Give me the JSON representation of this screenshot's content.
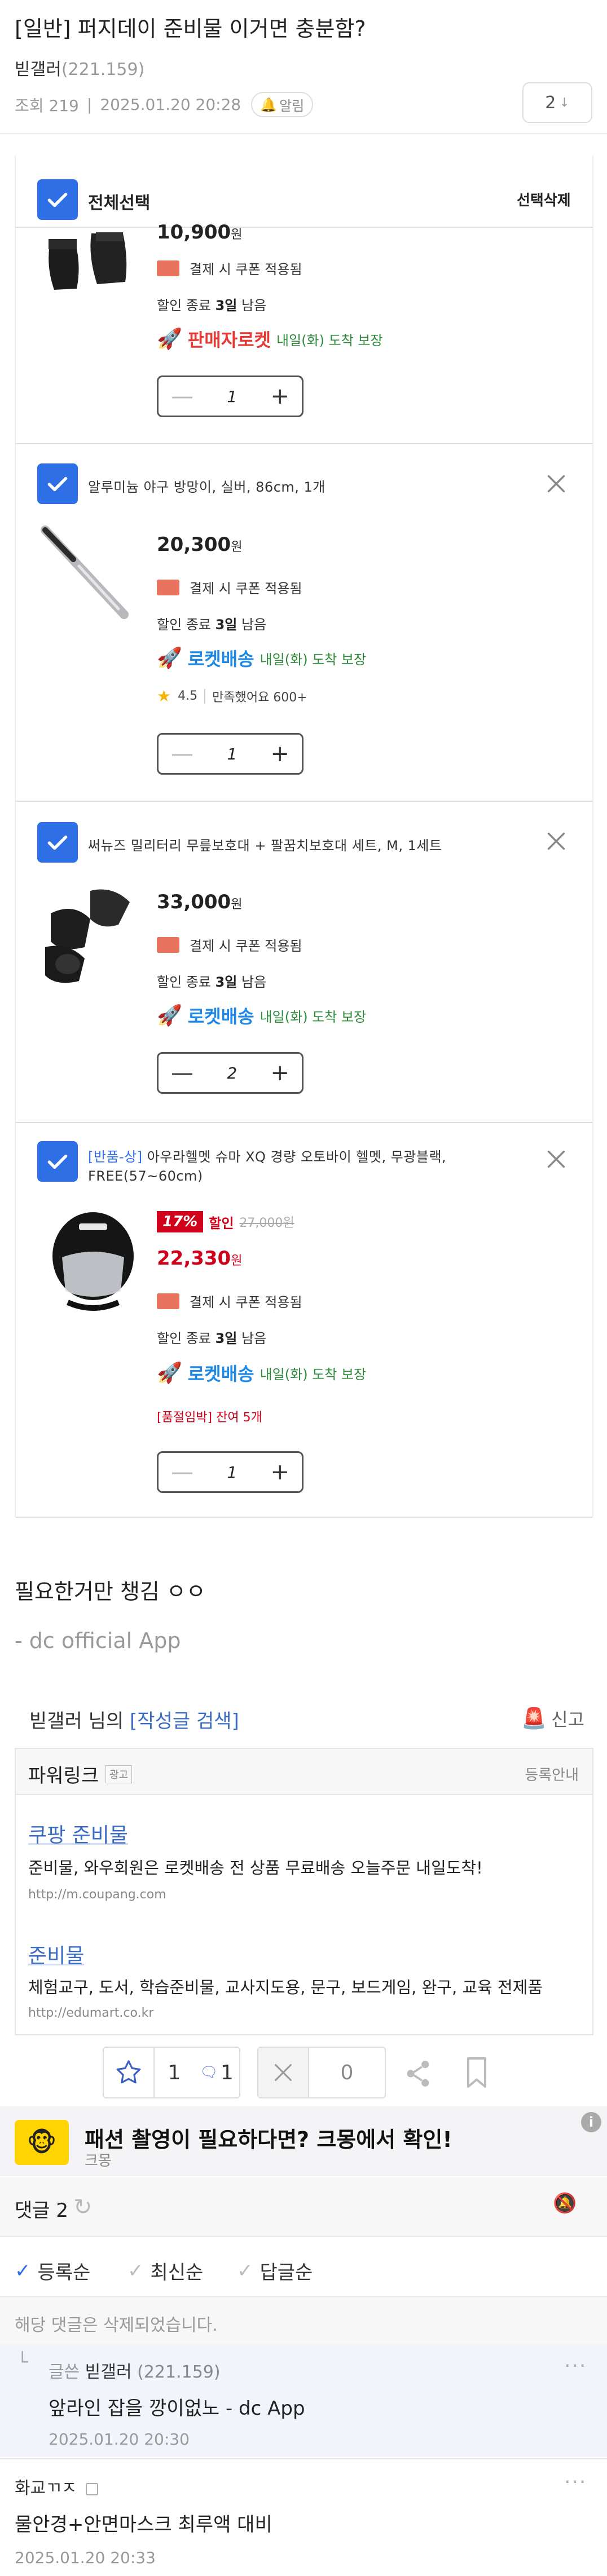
{
  "post": {
    "title": "[일반] 퍼지데이 준비물 이거면 충분함?",
    "author": "빋갤러",
    "author_ip": "(221.159)",
    "views_label": "조회 219",
    "date": "2025.01.20 20:28",
    "alarm_label": "알림",
    "comment_count": "2"
  },
  "cart": {
    "select_all_label": "전체선택",
    "delete_selected_label": "선택삭제",
    "items": [
      {
        "price": "10,900",
        "won": "원",
        "coupon": "결제 시 쿠폰 적용됨",
        "deal_end_prefix": "할인 종료",
        "deal_end_days": "3일",
        "deal_end_suffix": "남음",
        "delivery_brand": "판매자로켓",
        "delivery_when": "내일(화) 도착 보장",
        "qty": "1"
      },
      {
        "name": "알루미늄 야구 방망이, 실버, 86cm, 1개",
        "price": "20,300",
        "won": "원",
        "coupon": "결제 시 쿠폰 적용됨",
        "deal_end_prefix": "할인 종료",
        "deal_end_days": "3일",
        "deal_end_suffix": "남음",
        "delivery_brand": "로켓배송",
        "delivery_when": "내일(화) 도착 보장",
        "rating": "4.5",
        "bought": "만족했어요 600+",
        "qty": "1"
      },
      {
        "name": "써뉴즈 밀리터리 무릎보호대 + 팔꿈치보호대 세트, M, 1세트",
        "price": "33,000",
        "won": "원",
        "coupon": "결제 시 쿠폰 적용됨",
        "deal_end_prefix": "할인 종료",
        "deal_end_days": "3일",
        "deal_end_suffix": "남음",
        "delivery_brand": "로켓배송",
        "delivery_when": "내일(화) 도착 보장",
        "qty": "2"
      },
      {
        "name_tag": "[반품-상]",
        "name_line1": "아우라헬멧 슈마 XQ 경량 오토바이 헬멧, 무광블랙,",
        "name_line2": "FREE(57~60cm)",
        "discount_badge": "17%",
        "discount_word": "할인",
        "orig_price": "27,000원",
        "price": "22,330",
        "won": "원",
        "coupon": "결제 시 쿠폰 적용됨",
        "deal_end_prefix": "할인 종료",
        "deal_end_days": "3일",
        "deal_end_suffix": "남음",
        "delivery_brand": "로켓배송",
        "delivery_when": "내일(화) 도착 보장",
        "stock": "[품절임박] 잔여 5개",
        "qty": "1"
      }
    ]
  },
  "body": {
    "line1": "필요한거만 챙김 ㅇㅇ",
    "line2": "- dc official App"
  },
  "author_search": {
    "prefix": "빋갤러 님의",
    "link": "[작성글 검색]",
    "report_label": "신고"
  },
  "powerlink": {
    "title": "파워링크",
    "ad_chip": "광고",
    "register_label": "등록안내",
    "ads": [
      {
        "title": "쿠팡 준비물",
        "desc": "준비물, 와우회원은 로켓배송 전 상품 무료배송 오늘주문 내일도착!",
        "url": "http://m.coupang.com"
      },
      {
        "title": "준비물",
        "desc": "체험교구, 도서, 학습준비물, 교사지도용, 문구, 보드게임, 완구, 교육 전제품",
        "url": "http://edumart.co.kr"
      }
    ]
  },
  "votes": {
    "up": "1",
    "fix_up": "1",
    "down": "0"
  },
  "banner": {
    "title": "패션 촬영이 필요하다면? 크몽에서 확인!",
    "sub": "크몽",
    "info": "i"
  },
  "comments": {
    "label": "댓글 2",
    "sort_options": [
      "등록순",
      "최신순",
      "답글순"
    ],
    "deleted_text": "해당 댓글은 삭제되었습니다.",
    "reply": {
      "tag": "글쓴",
      "author": "빋갤러",
      "ip": "(221.159)",
      "text": "앞라인 잡을 깡이없노 - dc App",
      "time": "2025.01.20 20:30"
    },
    "comment2": {
      "author": "화교ㄲㅈ",
      "text": "물안경+안면마스크 최루액 대비",
      "time": "2025.01.20 20:33"
    }
  }
}
